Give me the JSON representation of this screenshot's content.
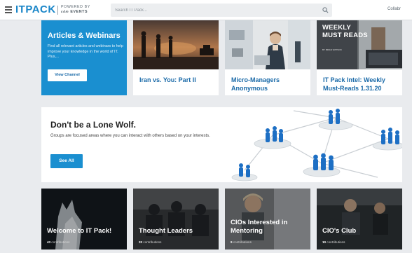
{
  "header": {
    "logo_text": "ITPACK",
    "powered_line1": "POWERED BY",
    "powered_line2": "EVENTS",
    "search_placeholder": "Search IT Pack...",
    "collab_label": "Collabr"
  },
  "featured": {
    "title": "Articles & Webinars",
    "description": "Find all relevant articles and webinars to help improve your knowledge in the world of IT. Plus,...",
    "button_label": "View Channel"
  },
  "articles": [
    {
      "title": "Iran vs. You: Part II"
    },
    {
      "title": "Micro-Managers Anonymous"
    },
    {
      "title": "IT Pack Intel: Weekly Must-Reads 1.31.20",
      "image_caption_line1": "WEEKLY",
      "image_caption_line2": "MUST READS",
      "image_byline": "BY BRIAN WATSON"
    }
  ],
  "banner": {
    "title": "Don't be a Lone Wolf.",
    "description": "Groups are focused areas where you can interact with others based on your interests.",
    "button_label": "See All"
  },
  "groups": [
    {
      "title": "Welcome to IT Pack!",
      "count": "43",
      "count_label": "contributions"
    },
    {
      "title": "Thought Leaders",
      "count": "33",
      "count_label": "contributions"
    },
    {
      "title": "CIOs Interested in Mentoring",
      "count": "9",
      "count_label": "contributions"
    },
    {
      "title": "CIO's Club",
      "count": "10",
      "count_label": "contributions"
    }
  ],
  "colors": {
    "brand_blue": "#1a8fd0",
    "link_blue": "#1a6aa8",
    "page_bg": "#e9ebee"
  }
}
